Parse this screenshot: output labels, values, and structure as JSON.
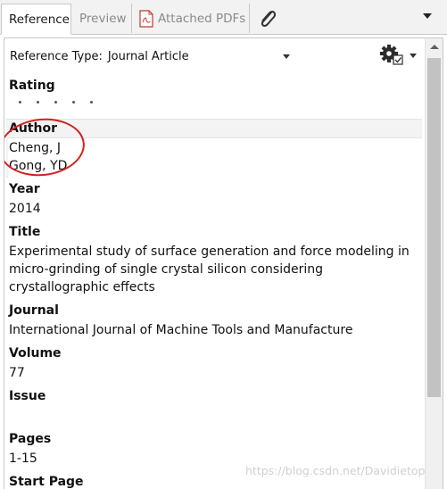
{
  "tabs": {
    "reference": "Reference",
    "preview": "Preview",
    "attached_pdfs": "Attached PDFs"
  },
  "reference_type": {
    "label": "Reference Type:",
    "value": "Journal Article"
  },
  "fields": {
    "rating_label": "Rating",
    "author_label": "Author",
    "authors": [
      "Cheng, J",
      "Gong, YD"
    ],
    "year_label": "Year",
    "year": "2014",
    "title_label": "Title",
    "title": "Experimental study of surface generation and force modeling in micro-grinding of single crystal silicon considering crystallographic effects",
    "journal_label": "Journal",
    "journal": "International Journal of Machine Tools and Manufacture",
    "volume_label": "Volume",
    "volume": "77",
    "issue_label": "Issue",
    "issue": "",
    "pages_label": "Pages",
    "pages": "1-15",
    "start_page_label": "Start Page"
  },
  "watermark": "https://blog.csdn.net/Davidietop",
  "colors": {
    "annotation_circle": "#d42020",
    "scroll_thumb": "#c2c2c2"
  },
  "icons": [
    "pdf-icon",
    "paperclip-icon",
    "gear-icon",
    "dropdown-arrow-icon"
  ]
}
